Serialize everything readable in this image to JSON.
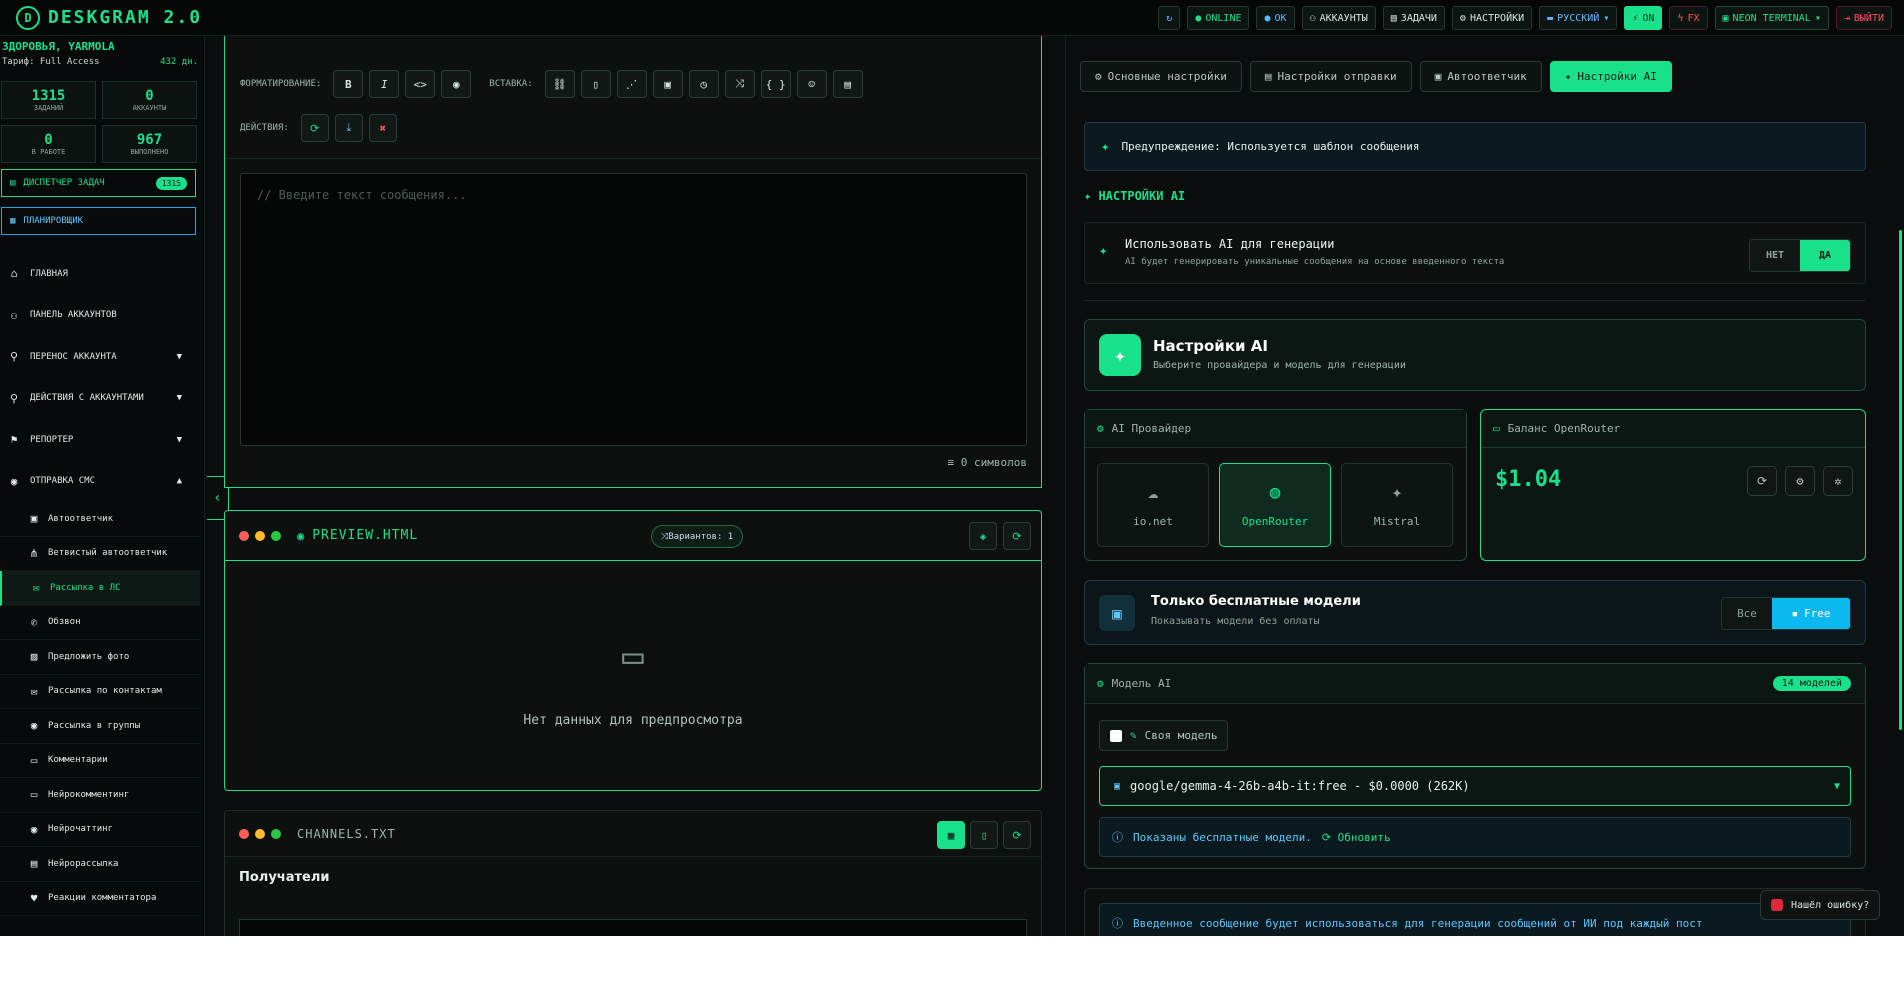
{
  "app": {
    "title": "DESKGRAM 2.0",
    "logo_glyph": "D"
  },
  "topbar": {
    "online": "ONLINE",
    "ok": "OK",
    "accounts": "АККАУНТЫ",
    "tasks": "ЗАДАЧИ",
    "settings": "НАСТРОЙКИ",
    "language": "РУССКИЙ",
    "on": "ON",
    "fx": "FX",
    "theme": "NEON TERMINAL",
    "logout": "ВЫЙТИ"
  },
  "sidebar": {
    "user": "ЗДОРОВЬЯ, YARMOLA",
    "tariff": "Тариф: Full Access",
    "days": "432 дн.",
    "stats": [
      {
        "value": "1315",
        "label": "ЗАДАНИЙ"
      },
      {
        "value": "0",
        "label": "АККАУНТЫ"
      },
      {
        "value": "0",
        "label": "В РАБОТЕ"
      },
      {
        "value": "967",
        "label": "ВЫПОЛНЕНО"
      }
    ],
    "dispatcher": "ДИСПЕТЧЕР ЗАДАЧ",
    "dispatcher_count": "1315",
    "scheduler": "ПЛАНИРОВЩИК",
    "nav": [
      {
        "label": "ГЛАВНАЯ",
        "icon": "home-icon"
      },
      {
        "label": "ПАНЕЛЬ АККАУНТОВ",
        "icon": "users-icon"
      },
      {
        "label": "ПЕРЕНОС АККАУНТА",
        "icon": "user-transfer-icon",
        "arrow": "▼"
      },
      {
        "label": "ДЕЙСТВИЯ С АККАУНТАМИ",
        "icon": "user-actions-icon",
        "arrow": "▼"
      },
      {
        "label": "РЕПОРТЕР",
        "icon": "flag-icon",
        "arrow": "▼"
      },
      {
        "label": "ОТПРАВКА СМС",
        "icon": "chat-icon",
        "arrow": "▲"
      }
    ],
    "sub": [
      {
        "label": "Автоответчик",
        "icon": "robot-icon"
      },
      {
        "label": "Ветвистый автоответчик",
        "icon": "branch-icon"
      },
      {
        "label": "Рассылка в ЛС",
        "icon": "mail-icon",
        "active": true
      },
      {
        "label": "Обзвон",
        "icon": "phone-icon"
      },
      {
        "label": "Предложить фото",
        "icon": "image-icon"
      },
      {
        "label": "Рассылка по контактам",
        "icon": "contacts-mail-icon"
      },
      {
        "label": "Рассылка в группы",
        "icon": "group-chat-icon"
      },
      {
        "label": "Комментарии",
        "icon": "comment-icon"
      },
      {
        "label": "Нейрокомментинг",
        "icon": "ai-comment-icon"
      },
      {
        "label": "Нейрочаттинг",
        "icon": "ai-chat-icon"
      },
      {
        "label": "Нейрорассылка",
        "icon": "ai-mail-icon"
      },
      {
        "label": "Реакции комментатора",
        "icon": "heart-icon"
      }
    ]
  },
  "editor": {
    "format_label": "ФОРМАТИРОВАНИЕ:",
    "insert_label": "ВСТАВКА:",
    "actions_label": "ДЕЙСТВИЯ:",
    "format_buttons": [
      "B",
      "I",
      "<>",
      "◉"
    ],
    "insert_buttons": [
      "⛓",
      "▯",
      "⋰",
      "▣",
      "◷",
      "⤨",
      "{ }",
      "☺",
      "▤"
    ],
    "placeholder": "// Введите текст сообщения...",
    "char_count": "0 символов"
  },
  "preview": {
    "title": "PREVIEW.HTML",
    "variants": "Вариантов: 1",
    "empty": "Нет данных для предпросмотра"
  },
  "channels": {
    "title": "CHANNELS.TXT",
    "recipients": "Получатели"
  },
  "rpanel": {
    "tabs": [
      "Основные настройки",
      "Настройки отправки",
      "Автоответчик",
      "Настройки AI"
    ],
    "warning": "Предупреждение: Используется шаблон сообщения",
    "section_title": "НАСТРОЙКИ AI",
    "use_ai_title": "Использовать AI для генерации",
    "use_ai_desc": "AI будет генерировать уникальные сообщения на основе введенного текста",
    "toggle_no": "НЕТ",
    "toggle_yes": "ДА",
    "ai_card_title": "Настройки AI",
    "ai_card_desc": "Выберите провайдера и модель для генерации",
    "provider_title": "AI Провайдер",
    "providers": [
      {
        "name": "io.net",
        "icon": "cloud-icon"
      },
      {
        "name": "OpenRouter",
        "icon": "globe-icon",
        "selected": true
      },
      {
        "name": "Mistral",
        "icon": "sparkles-icon"
      }
    ],
    "balance_title": "Баланс OpenRouter",
    "balance_value": "$1.04",
    "free_title": "Только бесплатные модели",
    "free_desc": "Показывать модели без оплаты",
    "free_all": "Все",
    "free_free": "Free",
    "model_title": "Модель AI",
    "model_count": "14 моделей",
    "custom_model": "Своя модель",
    "selected_model": "google/gemma-4-26b-a4b-it:free - $0.0000 (262K)",
    "info": "Показаны бесплатные модели.",
    "refresh": "Обновить",
    "note": "Введенное сообщение будет использоваться для генерации сообщений от ИИ под каждый пост"
  },
  "bug_report": "Нашёл ошибку?",
  "colors": {
    "accent": "#19e08a",
    "info": "#5fc6ff",
    "danger": "#ff4d5e"
  }
}
